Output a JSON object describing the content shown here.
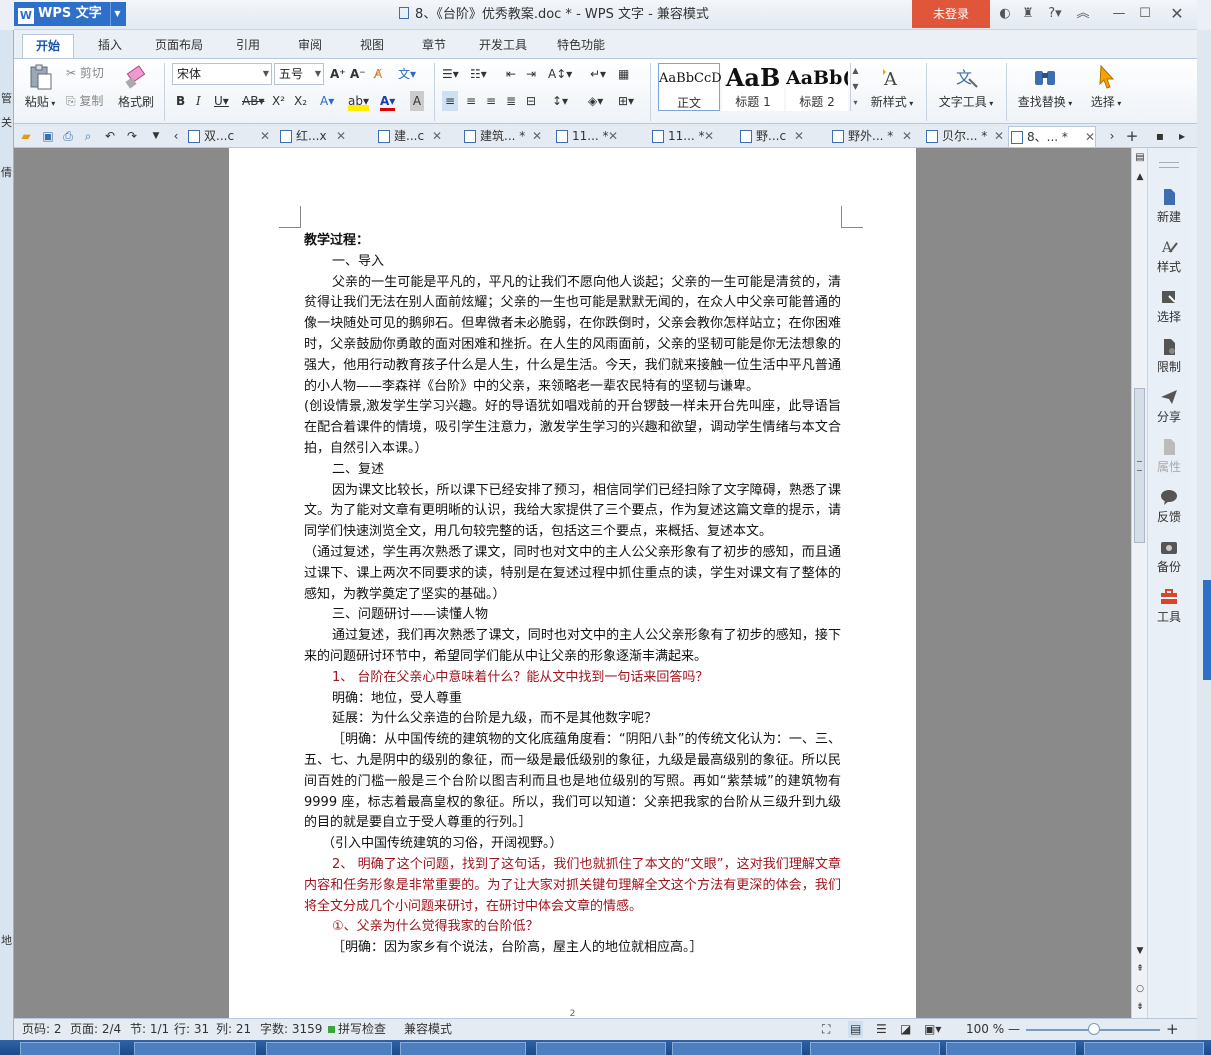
{
  "window": {
    "app_button": "WPS 文字",
    "title": "8、《台阶》优秀教案.doc * - WPS 文字 - 兼容模式",
    "login": "未登录"
  },
  "menu_tabs": [
    "开始",
    "插入",
    "页面布局",
    "引用",
    "审阅",
    "视图",
    "章节",
    "开发工具",
    "特色功能"
  ],
  "ribbon": {
    "paste": "粘贴",
    "cut": "剪切",
    "copy": "复制",
    "format_painter": "格式刷",
    "font_name": "宋体",
    "font_size": "五号",
    "styles": [
      {
        "preview": "AaBbCcD",
        "name": "正文"
      },
      {
        "preview": "AaB",
        "name": "标题 1"
      },
      {
        "preview": "AaBb(",
        "name": "标题 2"
      }
    ],
    "new_style": "新样式",
    "text_tools": "文字工具",
    "find_replace": "查找替换",
    "select": "选择"
  },
  "doc_tabs": [
    "双...c",
    "红...x",
    "建...c",
    "建筑... *",
    "11... *",
    "11... *",
    "野...c",
    "野外... *",
    "贝尔... *",
    "8、... *"
  ],
  "left_strip": [
    "管",
    "关",
    "倩",
    "地"
  ],
  "document": {
    "paragraphs": [
      {
        "text": "教学过程：",
        "cls": "bold"
      },
      {
        "text": "一、导入",
        "cls": "ind"
      },
      {
        "text": "父亲的一生可能是平凡的，平凡的让我们不愿向他人谈起；父亲的一生可能是清贫的，清贫得让我们无法在别人面前炫耀；父亲的一生也可能是默默无闻的，在众人中父亲可能普通的像一块随处可见的鹅卵石。但卑微者未必脆弱，在你跌倒时，父亲会教你怎样站立；在你困难时，父亲鼓励你勇敢的面对困难和挫折。在人生的风雨面前，父亲的坚韧可能是你无法想象的强大，他用行动教育孩子什么是人生，什么是生活。今天，我们就来接触一位生活中平凡普通的小人物——李森祥《台阶》中的父亲，来领略老一辈农民特有的坚韧与谦卑。",
        "cls": "ind"
      },
      {
        "text": "(创设情景,激发学生学习兴趣。好的导语犹如唱戏前的开台锣鼓一样未开台先叫座，此导语旨在配合着课件的情境，吸引学生注意力，激发学生学习的兴趣和欲望，调动学生情绪与本文合拍，自然引入本课。）",
        "cls": ""
      },
      {
        "text": "二、复述",
        "cls": "ind"
      },
      {
        "text": "因为课文比较长，所以课下已经安排了预习，相信同学们已经扫除了文字障碍，熟悉了课文。为了能对文章有更明晰的认识，我给大家提供了三个要点，作为复述这篇文章的提示，请同学们快速浏览全文，用几句较完整的话，包括这三个要点，来概括、复述本文。",
        "cls": "ind"
      },
      {
        "text": "（通过复述，学生再次熟悉了课文，同时也对文中的主人公父亲形象有了初步的感知，而且通过课下、课上两次不同要求的读，特别是在复述过程中抓住重点的读，学生对课文有了整体的感知，为教学奠定了坚实的基础。）",
        "cls": ""
      },
      {
        "text": "三、问题研讨——读懂人物",
        "cls": "ind"
      },
      {
        "text": "通过复述，我们再次熟悉了课文，同时也对文中的主人公父亲形象有了初步的感知，接下来的问题研讨环节中，希望同学们能从中让父亲的形象逐渐丰满起来。",
        "cls": "ind"
      },
      {
        "text": "1、 台阶在父亲心中意味着什么？能从文中找到一句话来回答吗？",
        "cls": "ind red"
      },
      {
        "text": "明确：地位，受人尊重",
        "cls": "ind"
      },
      {
        "text": "延展：为什么父亲造的台阶是九级，而不是其他数字呢？",
        "cls": "ind"
      },
      {
        "text": "［明确：从中国传统的建筑物的文化底蕴角度看：“阴阳八卦”的传统文化认为：一、三、五、七、九是阴中的级别的象征，而一级是最低级别的象征，九级是最高级别的象征。所以民间百姓的门槛一般是三个台阶以图吉利而且也是地位级别的写照。再如“紫禁城”的建筑物有 9999 座，标志着最高皇权的象征。所以，我们可以知道：父亲把我家的台阶从三级升到九级的目的就是要自立于受人尊重的行列。］",
        "cls": "ind"
      },
      {
        "text": "（引入中国传统建筑的习俗，开阔视野。）",
        "cls": "ind2"
      },
      {
        "text": "2、 明确了这个问题，找到了这句话，我们也就抓住了本文的“文眼”，这对我们理解文章内容和任务形象是非常重要的。为了让大家对抓关键句理解全文这个方法有更深的体会，我们将全文分成几个小问题来研讨，在研讨中体会文章的情感。",
        "cls": "ind red"
      },
      {
        "text": "①、父亲为什么觉得我家的台阶低？",
        "cls": "ind red"
      },
      {
        "text": "［明确：因为家乡有个说法，台阶高，屋主人的地位就相应高。］",
        "cls": "ind"
      }
    ],
    "page_number": "2"
  },
  "side_panel": [
    "新建",
    "样式",
    "选择",
    "限制",
    "分享",
    "属性",
    "反馈",
    "备份",
    "工具"
  ],
  "status": {
    "page_code": "页码: 2",
    "pages": "页面: 2/4",
    "section": "节: 1/1",
    "line": "行: 31",
    "column": "列: 21",
    "word_count": "字数: 3159",
    "spell_check": "拼写检查",
    "compat_mode": "兼容模式",
    "zoom": "100 %"
  }
}
